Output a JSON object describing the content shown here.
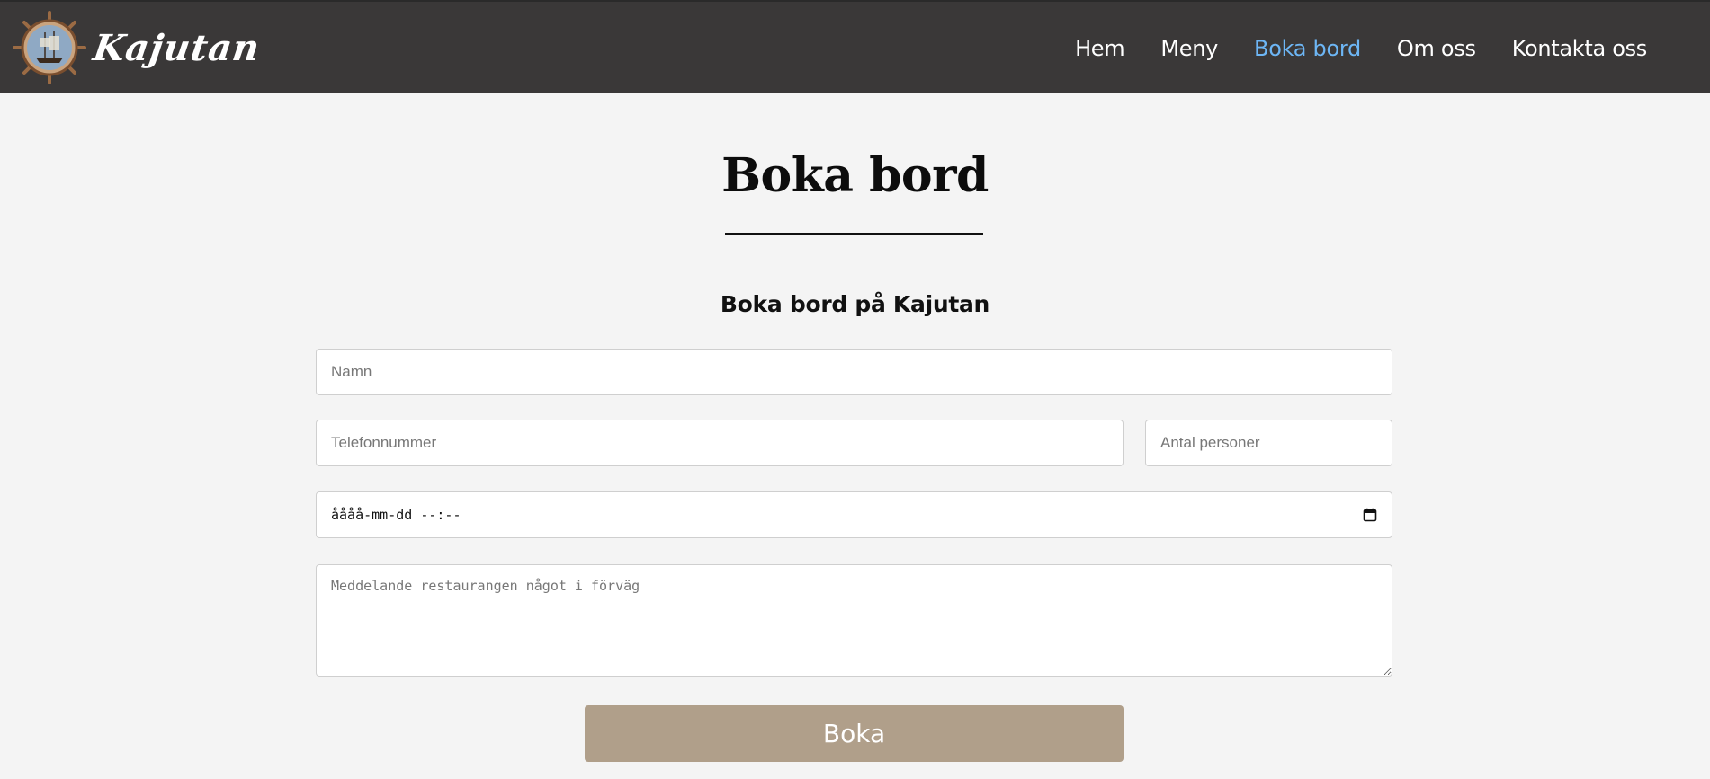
{
  "brand": {
    "name": "Kajutan"
  },
  "nav": {
    "items": [
      {
        "label": "Hem",
        "active": false
      },
      {
        "label": "Meny",
        "active": false
      },
      {
        "label": "Boka bord",
        "active": true
      },
      {
        "label": "Om oss",
        "active": false
      },
      {
        "label": "Kontakta oss",
        "active": false
      }
    ],
    "active_color": "#6db6f5"
  },
  "page": {
    "title": "Boka bord",
    "subtitle": "Boka bord på Kajutan"
  },
  "form": {
    "name_placeholder": "Namn",
    "phone_placeholder": "Telefonnummer",
    "guests_placeholder": "Antal personer",
    "datetime_value": "åååå-mm-dd --:--",
    "message_placeholder": "Meddelande restaurangen något i förväg",
    "submit_label": "Boka"
  },
  "colors": {
    "navbar": "#3a3838",
    "background": "#f4f4f4",
    "button": "#b09f8a"
  },
  "icons": {
    "logo": "ship-wheel-icon",
    "calendar": "calendar-icon"
  }
}
